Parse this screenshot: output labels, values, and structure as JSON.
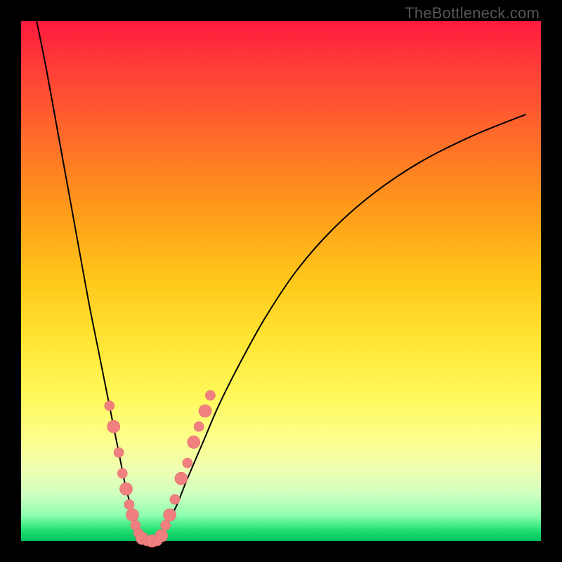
{
  "watermark": "TheBottleneck.com",
  "colors": {
    "gradient_top": "#ff1a3c",
    "gradient_mid": "#ffe635",
    "gradient_bottom": "#00c060",
    "curve": "#000000",
    "dot_fill": "#f08080",
    "dot_stroke": "#e06a6a",
    "frame": "#000000"
  },
  "chart_data": {
    "type": "line",
    "title": "",
    "xlabel": "",
    "ylabel": "",
    "xlim": [
      0,
      100
    ],
    "ylim": [
      0,
      100
    ],
    "grid": false,
    "legend": false,
    "note": "Two curves forming a V. Both descend to zero near x≈23 (left) and rise from zero near x≈27 (right). Background gradient encodes value: red≈100 (top) through yellow to green≈0 (bottom). Pink dots mark selected points on both curves near the V trough and along the bottom.",
    "series": [
      {
        "name": "left-curve",
        "x": [
          3,
          5,
          7,
          9,
          11,
          13,
          15,
          17,
          19,
          20,
          21,
          22,
          23,
          24
        ],
        "y": [
          100,
          90,
          79,
          68,
          57,
          46,
          36,
          26,
          16,
          11,
          7,
          3,
          1,
          0
        ]
      },
      {
        "name": "right-curve",
        "x": [
          26,
          27,
          28,
          30,
          32,
          35,
          38,
          42,
          47,
          53,
          60,
          68,
          77,
          87,
          97
        ],
        "y": [
          0,
          1,
          3,
          7,
          12,
          19,
          26,
          34,
          43,
          52,
          60,
          67,
          73,
          78,
          82
        ]
      }
    ],
    "dots": [
      {
        "x": 17.0,
        "y": 26,
        "size": "med"
      },
      {
        "x": 17.8,
        "y": 22,
        "size": "big"
      },
      {
        "x": 18.8,
        "y": 17,
        "size": "med"
      },
      {
        "x": 19.5,
        "y": 13,
        "size": "med"
      },
      {
        "x": 20.2,
        "y": 10,
        "size": "big"
      },
      {
        "x": 20.8,
        "y": 7,
        "size": "med"
      },
      {
        "x": 21.4,
        "y": 5,
        "size": "big"
      },
      {
        "x": 22.0,
        "y": 3,
        "size": "med"
      },
      {
        "x": 22.6,
        "y": 1.5,
        "size": "med"
      },
      {
        "x": 23.3,
        "y": 0.5,
        "size": "big"
      },
      {
        "x": 24.2,
        "y": 0,
        "size": "med"
      },
      {
        "x": 25.2,
        "y": 0,
        "size": "big"
      },
      {
        "x": 26.2,
        "y": 0,
        "size": "med"
      },
      {
        "x": 27.0,
        "y": 1,
        "size": "big"
      },
      {
        "x": 27.8,
        "y": 3,
        "size": "med"
      },
      {
        "x": 28.6,
        "y": 5,
        "size": "big"
      },
      {
        "x": 29.6,
        "y": 8,
        "size": "med"
      },
      {
        "x": 30.8,
        "y": 12,
        "size": "big"
      },
      {
        "x": 32.0,
        "y": 15,
        "size": "med"
      },
      {
        "x": 33.2,
        "y": 19,
        "size": "big"
      },
      {
        "x": 34.2,
        "y": 22,
        "size": "med"
      },
      {
        "x": 35.4,
        "y": 25,
        "size": "big"
      },
      {
        "x": 36.4,
        "y": 28,
        "size": "med"
      }
    ]
  }
}
